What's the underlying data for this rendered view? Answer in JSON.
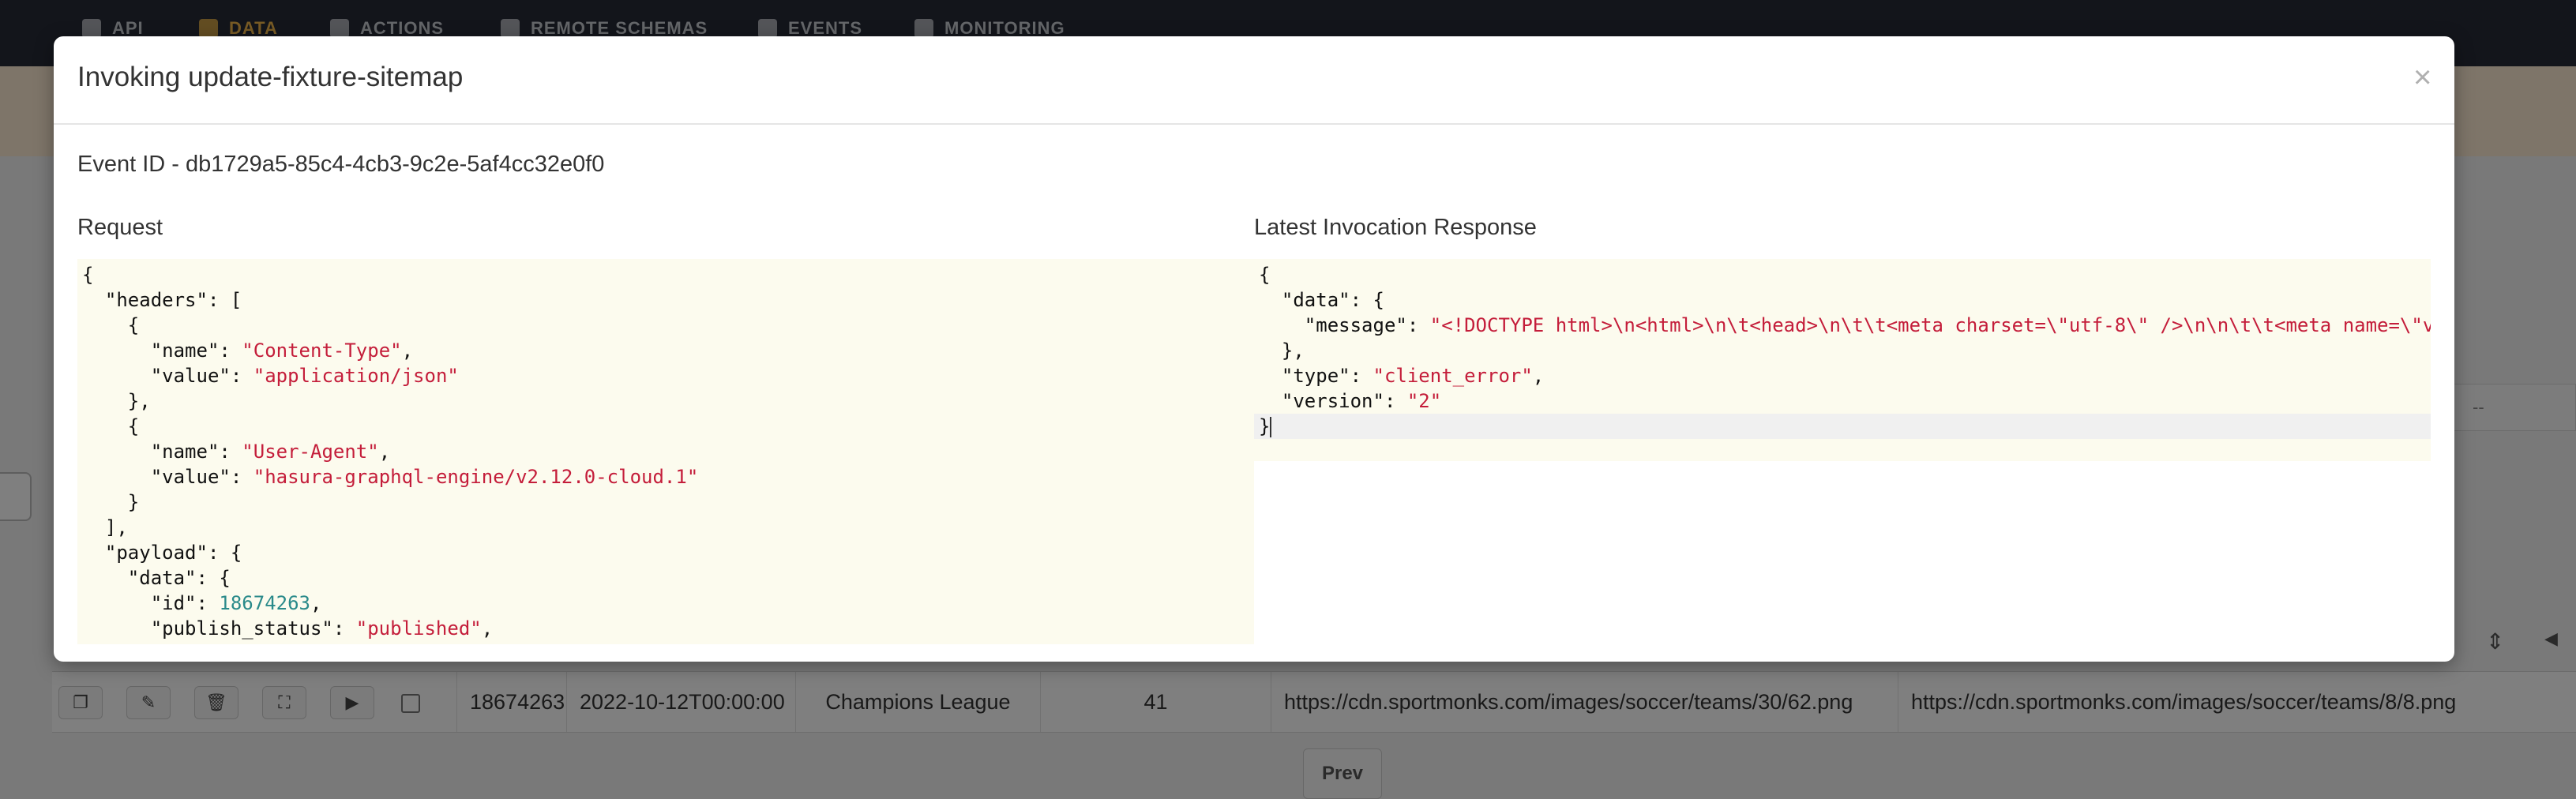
{
  "nav": {
    "items": [
      {
        "label": "API",
        "icon": "flask-icon"
      },
      {
        "label": "DATA",
        "icon": "database-icon",
        "active": true
      },
      {
        "label": "ACTIONS",
        "icon": "gears-icon"
      },
      {
        "label": "REMOTE SCHEMAS",
        "icon": "plug-icon"
      },
      {
        "label": "EVENTS",
        "icon": "cloud-icon"
      },
      {
        "label": "MONITORING",
        "icon": "chart-icon"
      }
    ],
    "active_color": "#f0b74a"
  },
  "background": {
    "empty_cell": "--"
  },
  "row": {
    "id": "18674263",
    "date": "2022-10-12T00:00:00",
    "league": "Champions League",
    "count": "41",
    "home_logo": "https://cdn.sportmonks.com/images/soccer/teams/30/62.png",
    "away_logo": "https://cdn.sportmonks.com/images/soccer/teams/8/8.png"
  },
  "pagination": {
    "prev_label": "Prev"
  },
  "modal": {
    "title": "Invoking update-fixture-sitemap",
    "close_glyph": "×",
    "event_id": "Event ID - db1729a5-85c4-4cb3-9c2e-5af4cc32e0f0",
    "request_title": "Request",
    "response_title": "Latest Invocation Response",
    "request": {
      "header1_name": "Content-Type",
      "header1_value": "application/json",
      "header2_name": "User-Agent",
      "header2_value": "hasura-graphql-engine/v2.12.0-cloud.1",
      "payload_id": "18674263",
      "publish_status": "published"
    },
    "response": {
      "message": "\"<!DOCTYPE html>\\n<html>\\n\\t<head>\\n\\t\\t<meta charset=\\\"utf-8\\\" />\\n\\n\\t\\t<meta name=\\\"v",
      "type": "client_error",
      "version": "2"
    }
  }
}
